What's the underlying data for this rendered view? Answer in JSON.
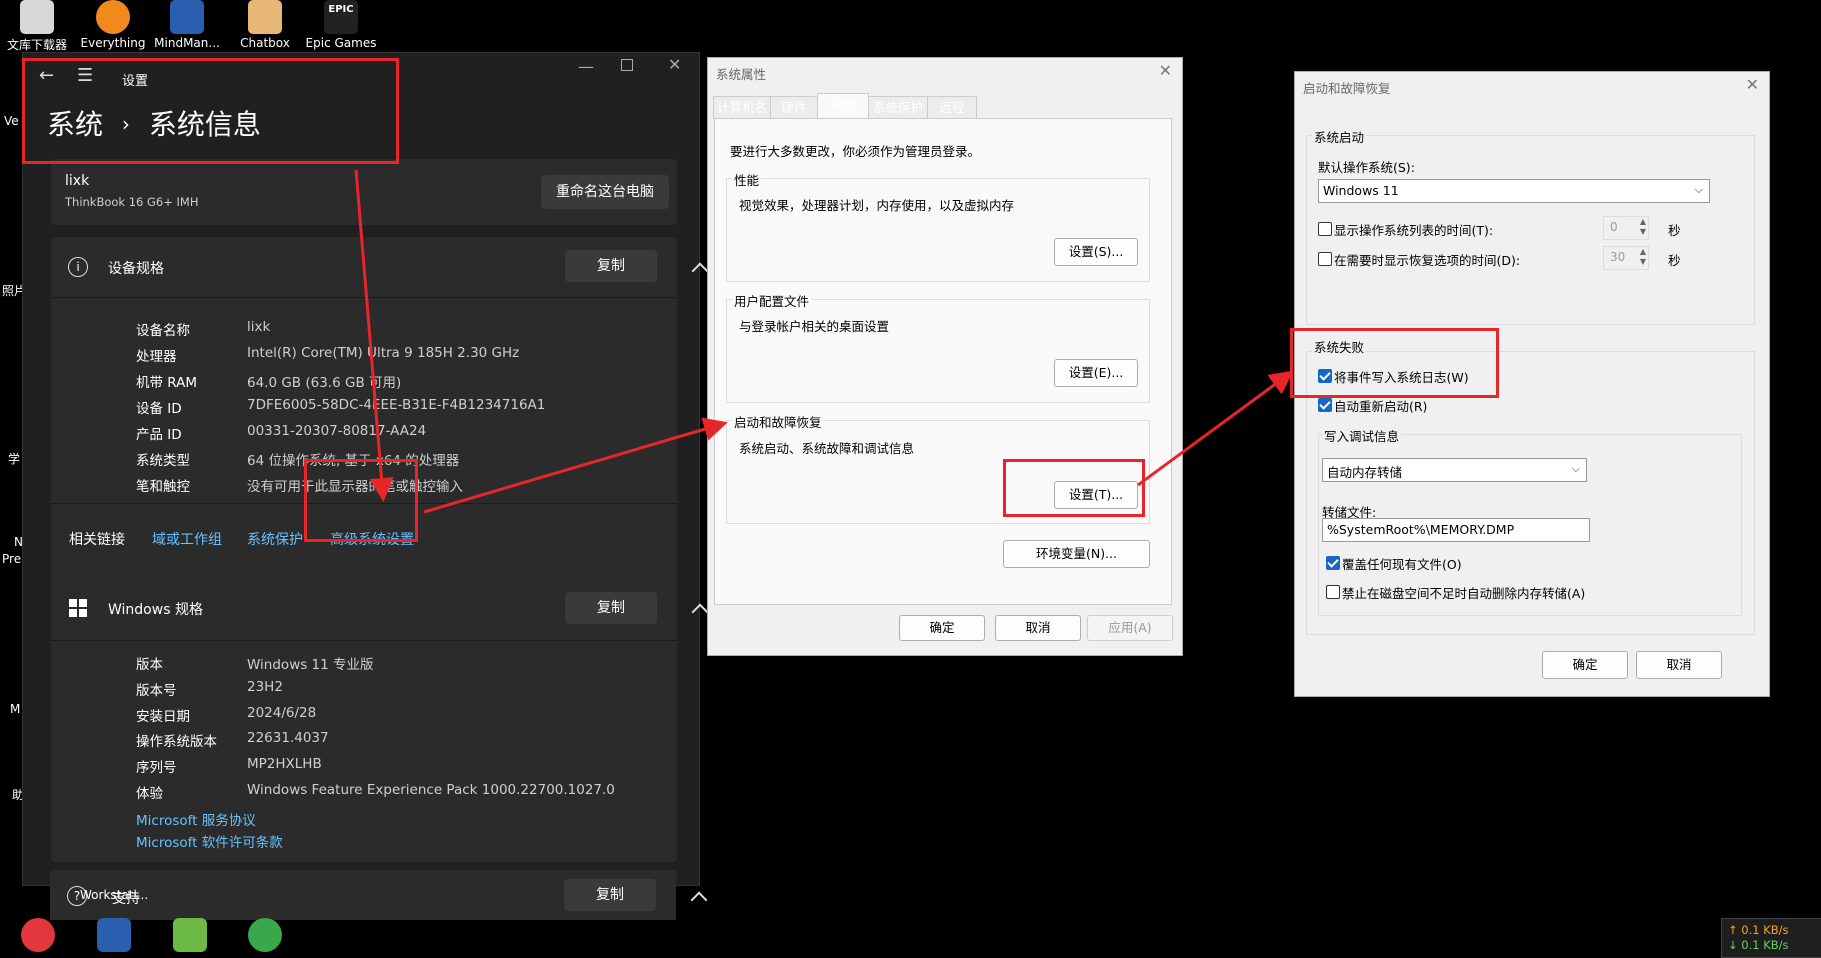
{
  "desktop": {
    "icons": [
      "文库下载器",
      "Everything",
      "MindMan...",
      "Chatbox",
      "Epic Games"
    ],
    "epic_logo": "EPIC",
    "left_edge": [
      "Ve",
      "照片",
      "学",
      "N",
      "Pre",
      "M",
      "助"
    ],
    "taskbar_label": "Workstati...",
    "net_up": "↑ 0.1 KB/s",
    "net_down": "↓ 0.1 KB/s"
  },
  "settings": {
    "title": "设置",
    "breadcrumb_root": "系统",
    "breadcrumb_sep": "›",
    "breadcrumb_page": "系统信息",
    "user_name": "lixk",
    "device_model": "ThinkBook 16 G6+ IMH",
    "rename_button": "重命名这台电脑",
    "device_specs_title": "设备规格",
    "copy_label": "复制",
    "device_specs": [
      {
        "label": "设备名称",
        "value": "lixk"
      },
      {
        "label": "处理器",
        "value": "Intel(R) Core(TM) Ultra 9 185H   2.30 GHz"
      },
      {
        "label": "机带 RAM",
        "value": "64.0 GB (63.6 GB 可用)"
      },
      {
        "label": "设备 ID",
        "value": "7DFE6005-58DC-4EEE-B31E-F4B1234716A1"
      },
      {
        "label": "产品 ID",
        "value": "00331-20307-80817-AA24"
      },
      {
        "label": "系统类型",
        "value": "64 位操作系统, 基于 x64 的处理器"
      },
      {
        "label": "笔和触控",
        "value": "没有可用于此显示器的笔或触控输入"
      }
    ],
    "related_links_label": "相关链接",
    "related_links": [
      "域或工作组",
      "系统保护",
      "高级系统设置"
    ],
    "windows_specs_title": "Windows 规格",
    "windows_specs": [
      {
        "label": "版本",
        "value": "Windows 11 专业版"
      },
      {
        "label": "版本号",
        "value": "23H2"
      },
      {
        "label": "安装日期",
        "value": "2024/6/28"
      },
      {
        "label": "操作系统版本",
        "value": "22631.4037"
      },
      {
        "label": "序列号",
        "value": "MP2HXLHB"
      },
      {
        "label": "体验",
        "value": "Windows Feature Experience Pack 1000.22700.1027.0"
      }
    ],
    "ms_links": [
      "Microsoft 服务协议",
      "Microsoft 软件许可条款"
    ],
    "support_title": "支持"
  },
  "sysprops": {
    "title": "系统属性",
    "tabs": [
      "计算机名",
      "硬件",
      "高级",
      "系统保护",
      "远程"
    ],
    "active_tab": "高级",
    "admin_note": "要进行大多数更改，你必须作为管理员登录。",
    "perf_title": "性能",
    "perf_desc": "视觉效果，处理器计划，内存使用，以及虚拟内存",
    "perf_button": "设置(S)...",
    "profile_title": "用户配置文件",
    "profile_desc": "与登录帐户相关的桌面设置",
    "profile_button": "设置(E)...",
    "startup_title": "启动和故障恢复",
    "startup_desc": "系统启动、系统故障和调试信息",
    "startup_button": "设置(T)...",
    "env_button": "环境变量(N)...",
    "ok": "确定",
    "cancel": "取消",
    "apply": "应用(A)"
  },
  "startup": {
    "title": "启动和故障恢复",
    "sys_start_group": "系统启动",
    "default_os_label": "默认操作系统(S):",
    "default_os_value": "Windows 11",
    "show_list_label": "显示操作系统列表的时间(T):",
    "show_list_value": "0",
    "show_recovery_label": "在需要时显示恢复选项的时间(D):",
    "show_recovery_value": "30",
    "seconds": "秒",
    "failure_group": "系统失败",
    "write_event_label": "将事件写入系统日志(W)",
    "auto_restart_label": "自动重新启动(R)",
    "debug_group": "写入调试信息",
    "debug_type": "自动内存转储",
    "dump_file_label": "转储文件:",
    "dump_file_value": "%SystemRoot%\\MEMORY.DMP",
    "overwrite_label": "覆盖任何现有文件(O)",
    "disable_auto_delete_label": "禁止在磁盘空间不足时自动删除内存转储(A)",
    "ok": "确定",
    "cancel": "取消"
  },
  "colors": {
    "accent_red": "#e8262a",
    "link_blue": "#66c3ff",
    "check_blue": "#1668c6"
  }
}
